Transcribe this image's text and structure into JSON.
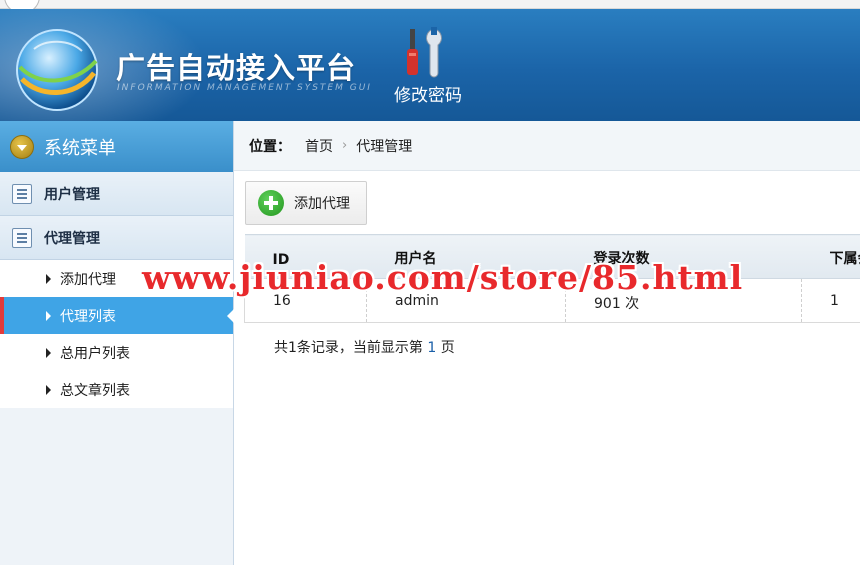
{
  "header": {
    "title": "广告自动接入平台",
    "subtitle": "INFORMATION MANAGEMENT SYSTEM GUI",
    "change_password": "修改密码"
  },
  "sidebar": {
    "title": "系统菜单",
    "groups": [
      {
        "label": "用户管理"
      },
      {
        "label": "代理管理"
      }
    ],
    "items": [
      {
        "label": "添加代理"
      },
      {
        "label": "代理列表"
      },
      {
        "label": "总用户列表"
      },
      {
        "label": "总文章列表"
      }
    ]
  },
  "breadcrumb": {
    "prefix": "位置：",
    "home": "首页",
    "current": "代理管理"
  },
  "toolbar": {
    "add_label": "添加代理"
  },
  "table": {
    "headers": [
      "ID",
      "用户名",
      "登录次数",
      "下属会"
    ],
    "rows": [
      [
        "16",
        "admin",
        "901 次",
        "1"
      ]
    ]
  },
  "pager": {
    "prefix": "共1条记录，当前显示第 ",
    "page": "1",
    "suffix": " 页"
  },
  "watermark": "www.jiuniao.com/store/85.html"
}
